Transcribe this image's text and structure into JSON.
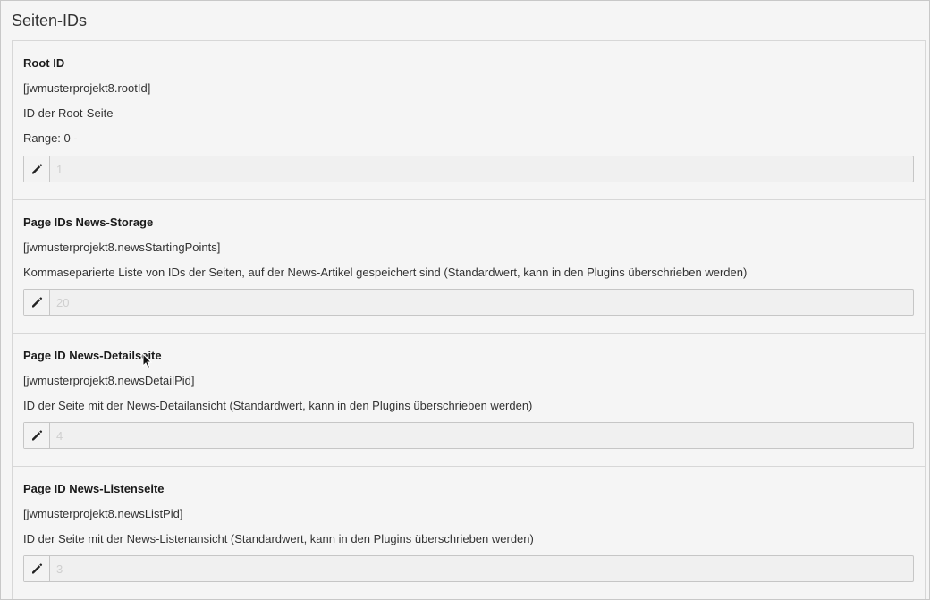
{
  "section": {
    "title": "Seiten-IDs"
  },
  "items": [
    {
      "title": "Root ID",
      "key": "[jwmusterprojekt8.rootId]",
      "description": "ID der Root-Seite",
      "range": "Range: 0 -",
      "value": "1"
    },
    {
      "title": "Page IDs News-Storage",
      "key": "[jwmusterprojekt8.newsStartingPoints]",
      "description": "Kommaseparierte Liste von IDs der Seiten, auf der News-Artikel gespeichert sind (Standardwert, kann in den Plugins überschrieben werden)",
      "value": "20"
    },
    {
      "title": "Page ID News-Detailseite",
      "key": "[jwmusterprojekt8.newsDetailPid]",
      "description": "ID der Seite mit der News-Detailansicht (Standardwert, kann in den Plugins überschrieben werden)",
      "value": "4"
    },
    {
      "title": "Page ID News-Listenseite",
      "key": "[jwmusterprojekt8.newsListPid]",
      "description": "ID der Seite mit der News-Listenansicht (Standardwert, kann in den Plugins überschrieben werden)",
      "value": "3"
    }
  ],
  "icons": {
    "edit": "pencil-icon",
    "cursor": "mouse-pointer-icon"
  },
  "colors": {
    "background": "#f5f5f5",
    "border": "#d7d7d7",
    "field_background": "#f0f0f0",
    "placeholder_text": "#cfcfcf"
  }
}
